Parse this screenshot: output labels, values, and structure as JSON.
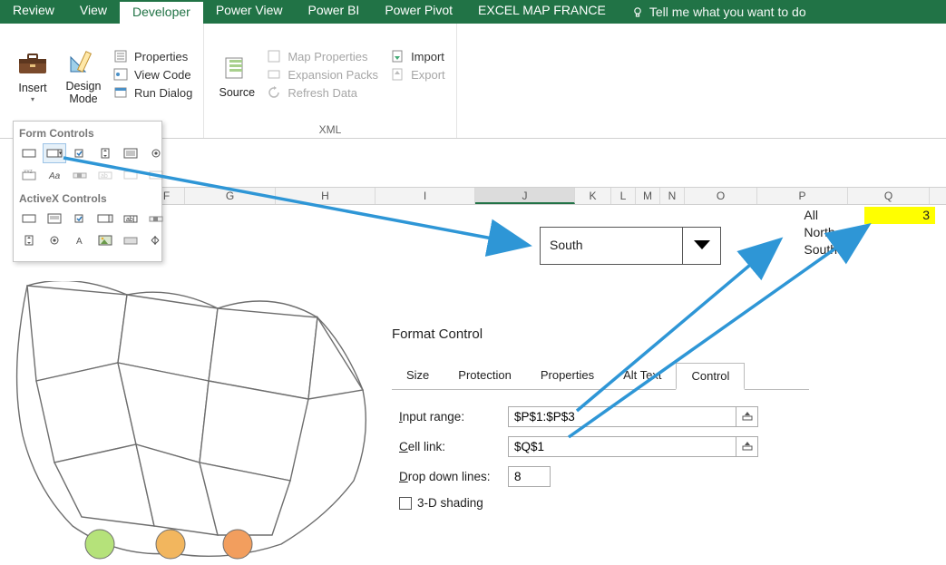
{
  "tabs": {
    "review": "Review",
    "view": "View",
    "developer": "Developer",
    "powerview": "Power View",
    "powerbi": "Power BI",
    "powerpivot": "Power Pivot",
    "excelmap": "EXCEL MAP FRANCE",
    "tellme": "Tell me what you want to do"
  },
  "ribbon": {
    "insert": "Insert",
    "design": "Design\nMode",
    "source": "Source",
    "code": {
      "properties": "Properties",
      "viewcode": "View Code",
      "rundialog": "Run Dialog"
    },
    "xml": {
      "mapprops": "Map Properties",
      "expansion": "Expansion Packs",
      "refresh": "Refresh Data",
      "import": "Import",
      "export": "Export",
      "title": "XML"
    }
  },
  "popup": {
    "formcontrols": "Form Controls",
    "activex": "ActiveX Controls"
  },
  "columns": [
    "F",
    "G",
    "H",
    "I",
    "J",
    "K",
    "L",
    "M",
    "N",
    "O",
    "P",
    "Q"
  ],
  "pcol": [
    "All",
    "North",
    "South"
  ],
  "qcol_value": "3",
  "combobox": {
    "value": "South"
  },
  "dlg": {
    "title": "Format Control",
    "tabs": {
      "size": "Size",
      "protection": "Protection",
      "properties": "Properties",
      "alttext": "Alt Text",
      "control": "Control"
    },
    "input_range_label": "nput range:",
    "input_range_pre": "I",
    "input_range_val": "$P$1:$P$3",
    "cell_link_label": "ell link:",
    "cell_link_pre": "C",
    "cell_link_val": "$Q$1",
    "dropdown_label": "rop down lines:",
    "dropdown_pre": "D",
    "dropdown_val": "8",
    "shading_label": "-D shading",
    "shading_pre": "3"
  }
}
